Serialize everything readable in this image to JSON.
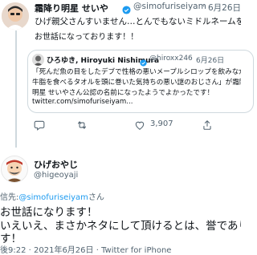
{
  "tweet1": {
    "name": "霜降り明星 せいや",
    "handle": "@simofuriseiyam",
    "dot": "·",
    "date": "6月26日",
    "text": "ひげ親父さんすいません…とんでもないミドルネームを公認してしまいました…"
  },
  "quote": {
    "reply_to": "お世話になっております！！",
    "name": "ひろゆき, Hiroyuki Nishimura",
    "handle": "@hiroxx246",
    "dot": "·",
    "date": "6月26日",
    "line1": "「死んだ魚の目をしたデブで性格の悪いメープルシロップを飲みながら",
    "line2": "牛脂を食べるタオルを頭に巻いた気持ちの悪い謎のおじさん」が霜降り",
    "line3": "明星 せいやさん公認の名前になったようでよかったです！",
    "link": "twitter.com/simofuriseiyam..."
  },
  "actions": {
    "reply_count": "",
    "retweet_count": "",
    "like_count": "3,907"
  },
  "tweet2": {
    "name": "ひげおやじ",
    "handle": "@higeoyaji",
    "reply_prefix": "信先:",
    "reply_to": "@simofuriseiyam",
    "reply_suffix": "さん",
    "line1": "お世話になります！",
    "line2": "いえいえ、まさかネタにして頂けるとは、誉であります",
    "line3": "す！",
    "meta": "後9:22 · 2021年6月26日 · Twitter for iPhone"
  },
  "colors": {
    "accent": "#1d9bf0",
    "text": "#0f1419",
    "muted": "#536471",
    "verified": "#1d9bf0"
  }
}
